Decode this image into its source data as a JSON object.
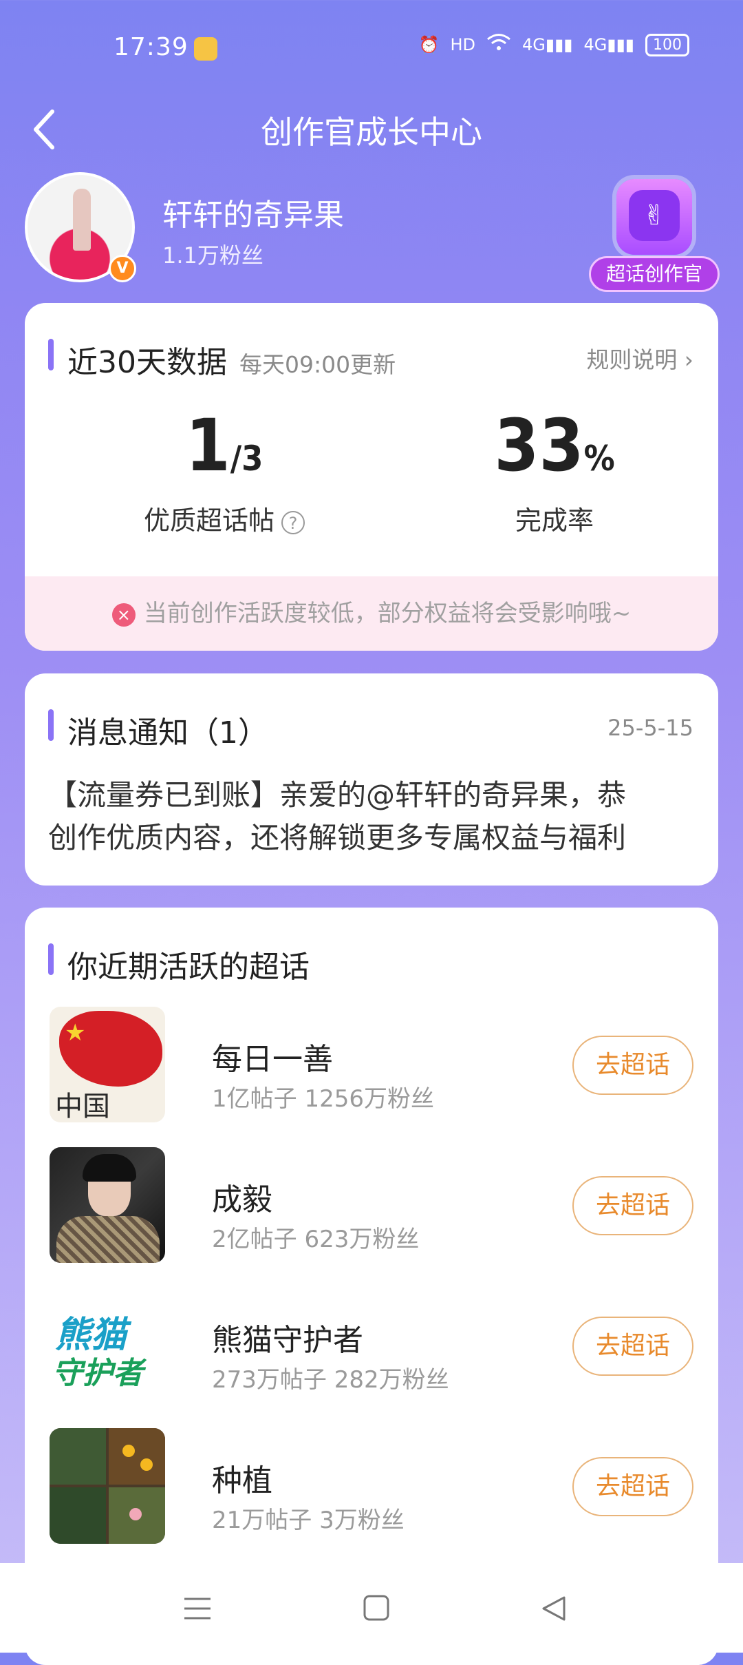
{
  "status_bar": {
    "time": "17:39",
    "battery": "100",
    "icons": [
      "alarm-icon",
      "hd-icon",
      "wifi-icon",
      "4g-signal-icon",
      "4g-signal-icon"
    ]
  },
  "header": {
    "title": "创作官成长中心",
    "back_icon": "chevron-left-icon"
  },
  "profile": {
    "username": "轩轩的奇异果",
    "fans": "1.1万粉丝",
    "verified_badge": "V",
    "officer_badge_label": "超话创作官"
  },
  "stats": {
    "title": "近30天数据",
    "subtitle": "每天09:00更新",
    "rules_link": "规则说明 ›",
    "quality_posts_value": "1",
    "quality_posts_total": "/3",
    "quality_posts_label": "优质超话帖",
    "help_icon": "?",
    "completion_value": "33",
    "completion_unit": "%",
    "completion_label": "完成率",
    "warning_icon": "×",
    "warning": "当前创作活跃度较低，部分权益将会受影响哦~"
  },
  "messages": {
    "title": "消息通知（1）",
    "date": "25-5-15",
    "line1": "【流量券已到账】亲爱的@轩轩的奇异果，恭",
    "line2": "创作优质内容，还将解锁更多专属权益与福利"
  },
  "topics": {
    "title": "你近期活跃的超话",
    "items": [
      {
        "name": "每日一善",
        "meta": "1亿帖子 1256万粉丝",
        "button": "去超话",
        "thumb_text": "中国"
      },
      {
        "name": "成毅",
        "meta": "2亿帖子 623万粉丝",
        "button": "去超话"
      },
      {
        "name": "熊猫守护者",
        "meta": "273万帖子 282万粉丝",
        "button": "去超话",
        "thumb_text_1": "熊猫",
        "thumb_text_2": "守护者"
      },
      {
        "name": "种植",
        "meta": "21万帖子 3万粉丝",
        "button": "去超话"
      }
    ]
  },
  "colors": {
    "accent": "#8a73f6",
    "button_text": "#e88a2c",
    "button_border": "#e9b47a",
    "warning_bg": "#fdeaf2",
    "warning_icon": "#ee5b7a"
  }
}
